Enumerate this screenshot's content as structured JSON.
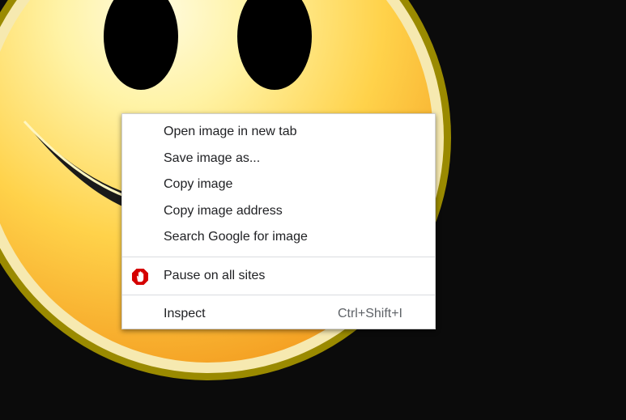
{
  "background": {
    "image": "smiley-face-icon",
    "colors": {
      "page": "#0b0b0b",
      "face_light": "#fff6b8",
      "face_dark": "#f5a41f",
      "rim_inner": "#ffe7a6",
      "rim_outer": "#9a8a00"
    }
  },
  "context_menu": {
    "items": [
      {
        "label": "Open image in new tab"
      },
      {
        "label": "Save image as..."
      },
      {
        "label": "Copy image"
      },
      {
        "label": "Copy image address"
      },
      {
        "label": "Search Google for image"
      }
    ],
    "extension_item": {
      "label": "Pause on all sites",
      "icon": "stop-hand-icon",
      "icon_color": "#d50000"
    },
    "inspect_item": {
      "label": "Inspect",
      "shortcut": "Ctrl+Shift+I"
    }
  }
}
